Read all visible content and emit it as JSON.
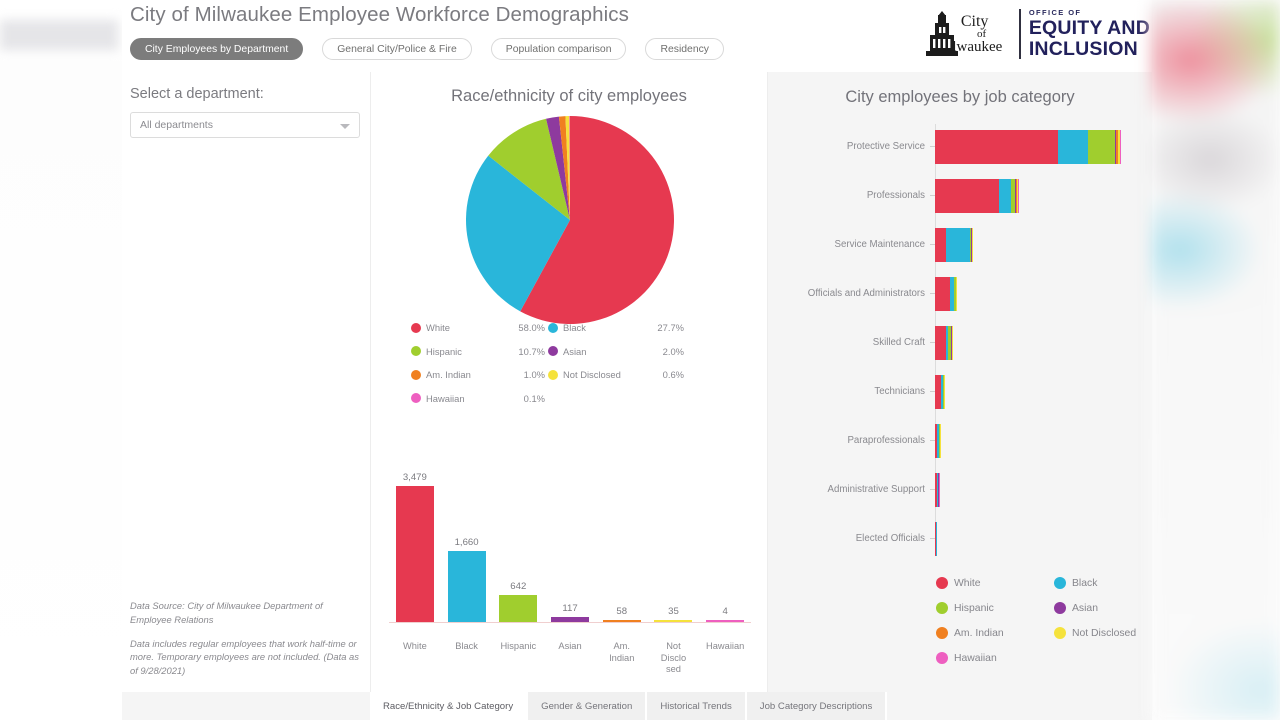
{
  "header": {
    "title": "City of Milwaukee Employee Workforce Demographics",
    "nav_pills": [
      {
        "label": "City Employees by Department",
        "active": true
      },
      {
        "label": "General City/Police & Fire",
        "active": false
      },
      {
        "label": "Population comparison",
        "active": false
      },
      {
        "label": "Residency",
        "active": false
      }
    ],
    "logo": {
      "city_line1": "City",
      "city_line2": "of",
      "city_line3": "Milwaukee",
      "office_of": "OFFICE OF",
      "equity_line1": "EQUITY AND",
      "equity_line2": "INCLUSION"
    }
  },
  "sidebar": {
    "select_label": "Select a department:",
    "department_value": "All departments",
    "footnote_1": "Data Source: City of Milwaukee Department of Employee Relations",
    "footnote_2": "Data includes regular employees that work half-time or more. Temporary employees are not included. (Data as of 9/28/2021)"
  },
  "colors": {
    "white": "#e63950",
    "black": "#29b6da",
    "hispanic": "#a0ce2e",
    "asian": "#8e3a9e",
    "am_indian": "#f08020",
    "not_disclosed": "#f5e23c",
    "hawaiian": "#ee5fc0"
  },
  "chart_data": [
    {
      "type": "pie",
      "title": "Race/ethnicity of city employees",
      "categories": [
        "White",
        "Black",
        "Hispanic",
        "Asian",
        "Am. Indian",
        "Not Disclosed",
        "Hawaiian"
      ],
      "values": [
        58.0,
        27.7,
        10.7,
        2.0,
        1.0,
        0.6,
        0.1
      ],
      "value_labels": [
        "58.0%",
        "27.7%",
        "10.7%",
        "2.0%",
        "1.0%",
        "0.6%",
        "0.1%"
      ],
      "colors": [
        "#e63950",
        "#29b6da",
        "#a0ce2e",
        "#8e3a9e",
        "#f08020",
        "#f5e23c",
        "#ee5fc0"
      ],
      "legend_order": [
        "White",
        "Black",
        "Hispanic",
        "Asian",
        "Am. Indian",
        "Not Disclosed",
        "Hawaiian"
      ],
      "legend_position": "below"
    },
    {
      "type": "bar",
      "title": "",
      "categories": [
        "White",
        "Black",
        "Hispanic",
        "Asian",
        "Am. Indian",
        "Not Disclosed",
        "Hawaiian"
      ],
      "category_labels": [
        "White",
        "Black",
        "Hispanic",
        "Asian",
        "Am.\nIndian",
        "Not\nDisclo\nsed",
        "Hawaiian"
      ],
      "values": [
        3479,
        1660,
        642,
        117,
        58,
        35,
        4
      ],
      "value_labels": [
        "3,479",
        "1,660",
        "642",
        "117",
        "58",
        "35",
        "4"
      ],
      "colors": [
        "#e63950",
        "#29b6da",
        "#a0ce2e",
        "#8e3a9e",
        "#f08020",
        "#f5e23c",
        "#ee5fc0"
      ],
      "xlabel": "",
      "ylabel": "",
      "ylim": [
        0,
        3479
      ],
      "grid": false
    },
    {
      "type": "bar",
      "orientation": "horizontal",
      "stacked": true,
      "title": "City employees by job category",
      "categories": [
        "Protective Service",
        "Professionals",
        "Service Maintenance",
        "Officials and Administrators",
        "Skilled Craft",
        "Technicians",
        "Paraprofessionals",
        "Administrative Support",
        "Elected Officials"
      ],
      "series": [
        {
          "name": "White",
          "color": "#e63950",
          "values": [
            1312,
            680,
            116,
            155,
            112,
            68,
            19,
            17,
            1
          ]
        },
        {
          "name": "Black",
          "color": "#29b6da",
          "values": [
            318,
            125,
            258,
            50,
            23,
            22,
            19,
            14,
            1
          ]
        },
        {
          "name": "Hispanic",
          "color": "#a0ce2e",
          "values": [
            278,
            44,
            13,
            17,
            40,
            5,
            16,
            6,
            0
          ]
        },
        {
          "name": "Asian",
          "color": "#8e3a9e",
          "values": [
            20,
            12,
            2,
            3,
            2,
            2,
            1,
            1,
            0
          ]
        },
        {
          "name": "Am. Indian",
          "color": "#f08020",
          "values": [
            22,
            7,
            7,
            3,
            3,
            2,
            1,
            1,
            0
          ]
        },
        {
          "name": "Not Disclosed",
          "color": "#f5e23c",
          "values": [
            14,
            10,
            1,
            4,
            1,
            1,
            1,
            1,
            0
          ]
        },
        {
          "name": "Hawaiian",
          "color": "#ee5fc0",
          "values": [
            2,
            1,
            0,
            0,
            0,
            0,
            0,
            1,
            0
          ]
        }
      ],
      "legend_entries": [
        "White",
        "Black",
        "Hispanic",
        "Asian",
        "Am. Indian",
        "Not Disclosed",
        "Hawaiian"
      ],
      "legend_position": "bottom"
    }
  ],
  "legend": {
    "rows": [
      {
        "name": "White",
        "value": "58.0%",
        "color": "#e63950"
      },
      {
        "name": "Black",
        "value": "27.7%",
        "color": "#29b6da"
      },
      {
        "name": "Hispanic",
        "value": "10.7%",
        "color": "#a0ce2e"
      },
      {
        "name": "Asian",
        "value": "2.0%",
        "color": "#8e3a9e"
      },
      {
        "name": "Am. Indian",
        "value": "1.0%",
        "color": "#f08020"
      },
      {
        "name": "Not Disclosed",
        "value": "0.6%",
        "color": "#f5e23c"
      },
      {
        "name": "Hawaiian",
        "value": "0.1%",
        "color": "#ee5fc0"
      }
    ]
  },
  "tabs": [
    {
      "label": "Race/Ethnicity & Job Category",
      "active": true
    },
    {
      "label": "Gender & Generation",
      "active": false
    },
    {
      "label": "Historical Trends",
      "active": false
    },
    {
      "label": "Job Category Descriptions",
      "active": false
    }
  ]
}
